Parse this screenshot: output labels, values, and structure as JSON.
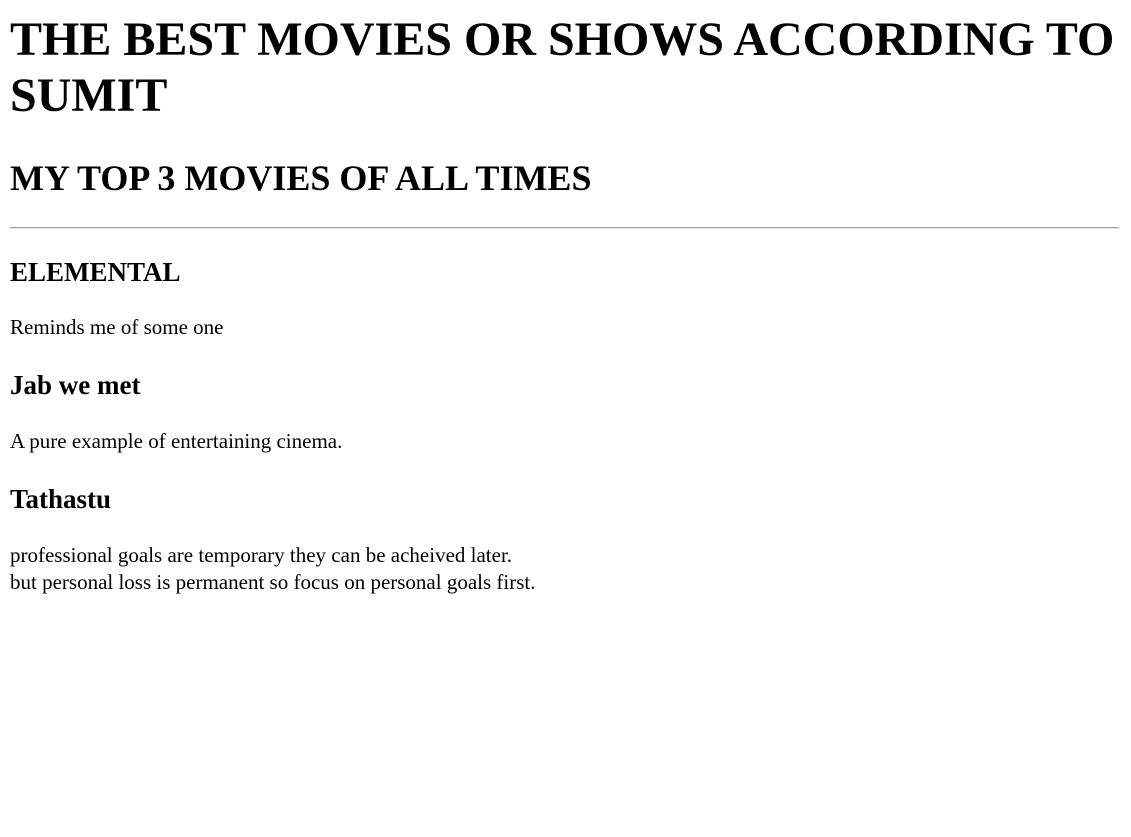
{
  "page": {
    "title": "THE BEST MOVIES OR SHOWS ACCORDING TO SUMIT",
    "subtitle": "MY TOP 3 MOVIES OF ALL TIMES"
  },
  "movies": [
    {
      "name": "ELEMENTAL",
      "description": [
        "Reminds me of some one"
      ]
    },
    {
      "name": "Jab we met",
      "description": [
        "A pure example of entertaining cinema."
      ]
    },
    {
      "name": "Tathastu",
      "description": [
        "professional goals are temporary they can be acheived later.",
        "but personal loss is permanent so focus on personal goals first."
      ]
    }
  ]
}
